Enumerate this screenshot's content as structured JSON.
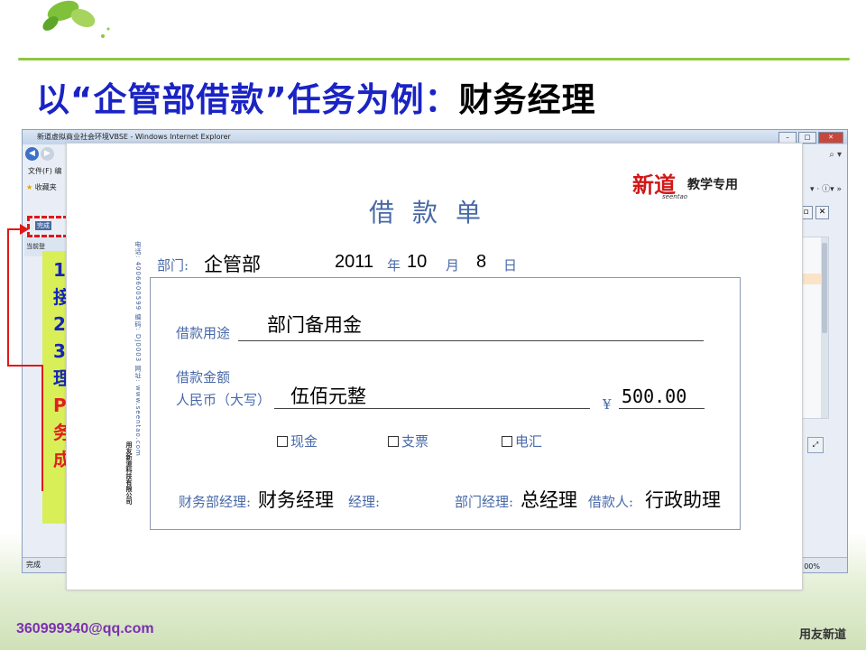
{
  "slide": {
    "title_blue": "以“企管部借款”任务为例：",
    "title_black": "财务经理",
    "email": "360999340@qq.com",
    "brand": "用友新道"
  },
  "browser": {
    "window_title": "新道虚拟商业社会环境VBSE - Windows Internet Explorer",
    "menu_file": "文件(F)",
    "menu_edit": "编",
    "favorites": "收藏夹",
    "status": "完成",
    "zoom": "00%",
    "sub_tab": "当前登",
    "dashed_label": "完成",
    "colors": {
      "titlebar": "#c3d3ea",
      "close": "#c8473c"
    }
  },
  "notes": {
    "lines": [
      "1",
      "接",
      "2",
      "3",
      "理",
      "P",
      "务",
      "成"
    ],
    "red_lines": [
      "P",
      "务",
      "成"
    ]
  },
  "form": {
    "title": "借款单",
    "logo": "新道",
    "logo_sub": "seentao",
    "logo_note": "教学专用",
    "side_text": "电话: 4006600599 编码: DJ0003 网址: www.seentao.com",
    "side_company": "用友新道科技有限公司",
    "dept_label": "部门:",
    "dept_value": "企管部",
    "year": "2011",
    "year_label": "年",
    "month": "10",
    "month_label": "月",
    "day": "8",
    "day_label": "日",
    "purpose_label": "借款用途",
    "purpose_value": "部门备用金",
    "amount_label": "借款金额",
    "rmb_label": "人民币（大写）",
    "amount_words": "伍佰元整",
    "yen": "¥",
    "amount_number": "500.00",
    "pay_cash": "现金",
    "pay_check": "支票",
    "pay_wire": "电汇",
    "finance_mgr_label": "财务部经理:",
    "finance_mgr_value": "财务经理",
    "mgr_label_tail": "经理:",
    "dept_mgr_label": "部门经理:",
    "dept_mgr_value": "总经理",
    "borrower_label": "借款人:",
    "borrower_value": "行政助理"
  }
}
